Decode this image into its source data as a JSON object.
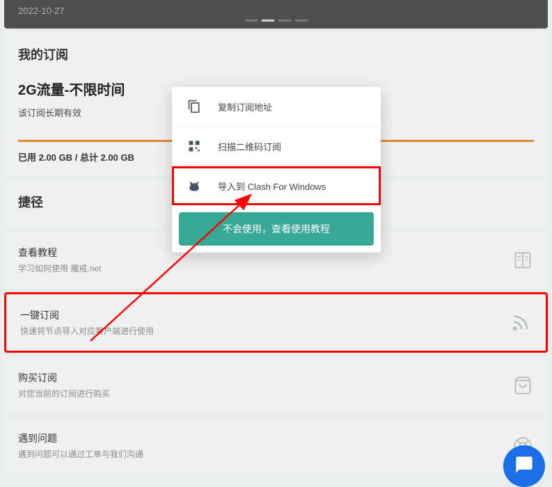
{
  "banner": {
    "date": "2022-10-27"
  },
  "subscription": {
    "sectionTitle": "我的订阅",
    "planTitle": "2G流量-不限时间",
    "planDesc": "该订阅长期有效",
    "usage": "已用 2.00 GB / 总计 2.00 GB"
  },
  "shortcuts": {
    "sectionTitle": "捷径",
    "items": [
      {
        "title": "查看教程",
        "sub": "学习如何使用 魔戒.net"
      },
      {
        "title": "一键订阅",
        "sub": "快速将节点导入对应客户端进行使用"
      },
      {
        "title": "购买订阅",
        "sub": "对您当前的订阅进行购买"
      },
      {
        "title": "遇到问题",
        "sub": "遇到问题可以通过工单与我们沟通"
      }
    ]
  },
  "modal": {
    "items": [
      {
        "label": "复制订阅地址"
      },
      {
        "label": "扫描二维码订阅"
      },
      {
        "label": "导入到 Clash For Windows"
      }
    ],
    "footerBtn": "不会使用，查看使用教程"
  }
}
